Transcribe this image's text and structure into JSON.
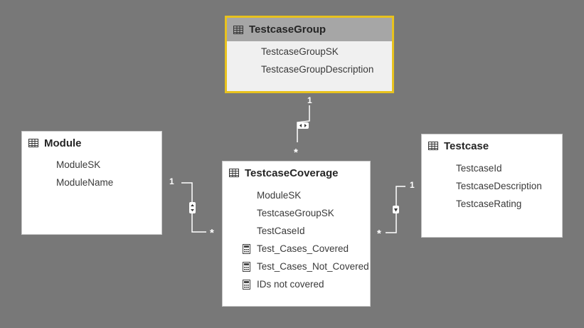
{
  "tables": {
    "testcase_group": {
      "name": "TestcaseGroup",
      "fields": [
        "TestcaseGroupSK",
        "TestcaseGroupDescription"
      ]
    },
    "module": {
      "name": "Module",
      "fields": [
        "ModuleSK",
        "ModuleName"
      ]
    },
    "testcase_coverage": {
      "name": "TestcaseCoverage",
      "fields": [
        "ModuleSK",
        "TestcaseGroupSK",
        "TestCaseId"
      ],
      "measures": [
        "Test_Cases_Covered",
        "Test_Cases_Not_Covered",
        "IDs not covered"
      ]
    },
    "testcase": {
      "name": "Testcase",
      "fields": [
        "TestcaseId",
        "TestcaseDescription",
        "TestcaseRating"
      ]
    }
  },
  "relationships": [
    {
      "from": "TestcaseGroup",
      "to": "TestcaseCoverage",
      "from_card": "1",
      "to_card": "*",
      "direction": "both"
    },
    {
      "from": "Module",
      "to": "TestcaseCoverage",
      "from_card": "1",
      "to_card": "*",
      "direction": "both"
    },
    {
      "from": "Testcase",
      "to": "TestcaseCoverage",
      "from_card": "1",
      "to_card": "*",
      "direction": "single"
    }
  ],
  "colors": {
    "canvas": "#787878",
    "card": "#ffffff",
    "selected_border": "#e8c21e",
    "selected_header": "#a6a6a6",
    "link": "#ffffff"
  },
  "icons": {
    "table": "table-grid-icon",
    "measure": "calculator-icon"
  }
}
